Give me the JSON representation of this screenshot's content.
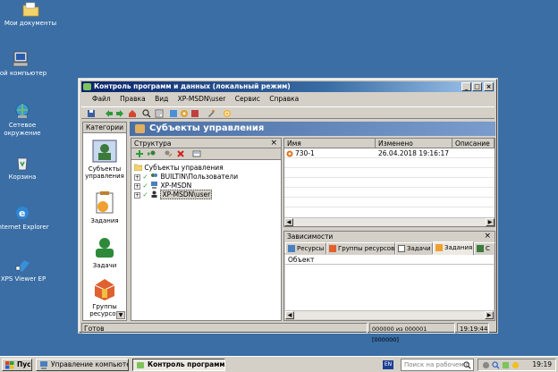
{
  "desktop": {
    "icons": [
      {
        "label": "Мои документы"
      },
      {
        "label": "Мой компьютер"
      },
      {
        "label": "Сетевое окружение"
      },
      {
        "label": "Корзина"
      },
      {
        "label": "Internet Explorer"
      },
      {
        "label": "XPS Viewer EP"
      }
    ]
  },
  "window": {
    "title": "Контроль программ и данных (локальный режим)",
    "buttons": {
      "minimize": "_",
      "maximize": "□",
      "close": "×"
    },
    "menu": [
      "Файл",
      "Правка",
      "Вид",
      "XP-MSDN\\user",
      "Сервис",
      "Справка"
    ],
    "categories": {
      "header": "Категории",
      "items": [
        {
          "label": "Субъекты управления"
        },
        {
          "label": "Задания"
        },
        {
          "label": "Задачи"
        },
        {
          "label": "Группы ресурсов"
        }
      ]
    },
    "main_title": "Субъекты управления",
    "tree": {
      "header": "Структура",
      "close": "×",
      "root": "Субъекты управления",
      "nodes": [
        {
          "label": "BUILTIN\\Пользователи"
        },
        {
          "label": "XP-MSDN"
        },
        {
          "label": "XP-MSDN\\user"
        }
      ]
    },
    "grid": {
      "columns": [
        "Имя",
        "Изменено",
        "Описание"
      ],
      "rows": [
        {
          "name": "730-1",
          "modified": "26.04.2018 19:16:17",
          "description": ""
        }
      ]
    },
    "deps": {
      "header": "Зависимости",
      "close": "×",
      "tabs": [
        "Ресурсы",
        "Группы ресурсов",
        "Задачи",
        "Задания",
        "С"
      ],
      "column": "Объект"
    },
    "status": {
      "text": "Готов",
      "counter": "000000 из 000001 [000000]",
      "time": "19:19:44"
    }
  },
  "taskbar": {
    "start": "Пуск",
    "tasks": [
      "Управление компьюте...",
      "Контроль программ ..."
    ],
    "lang": "EN",
    "search_placeholder": "Поиск на рабочем с",
    "clock": "19:19"
  },
  "colors": {
    "desktop": "#3a6ea5",
    "titlebar": "#0a246a",
    "face": "#d4d0c8",
    "header": "#4a6fa5"
  }
}
